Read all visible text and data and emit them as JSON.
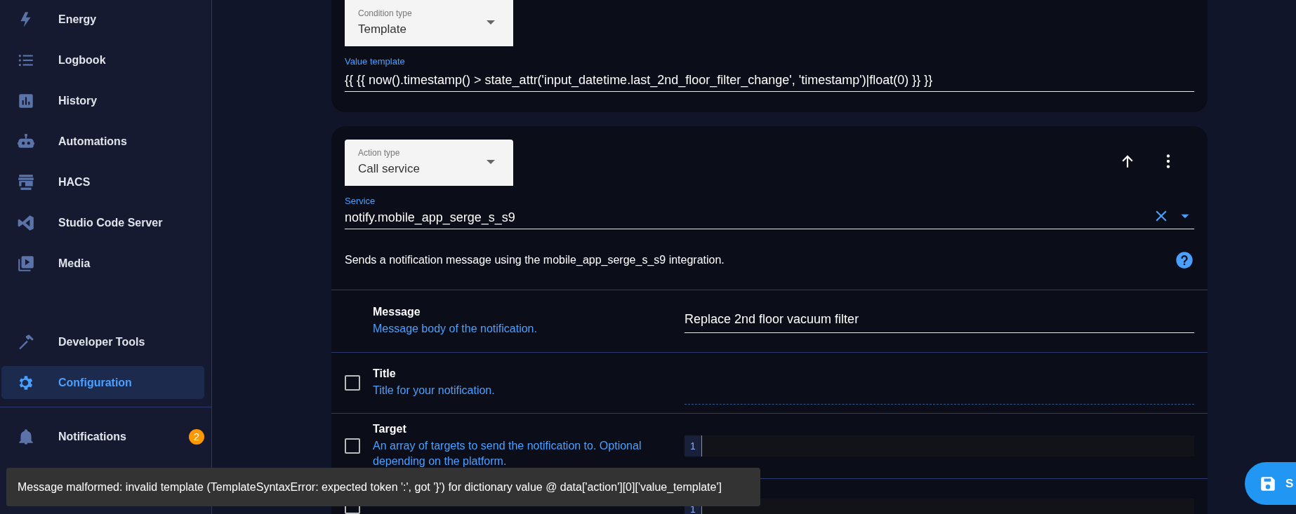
{
  "sidebar": {
    "items": [
      {
        "label": "Energy",
        "selected": false
      },
      {
        "label": "Logbook",
        "selected": false
      },
      {
        "label": "History",
        "selected": false
      },
      {
        "label": "Automations",
        "selected": false
      },
      {
        "label": "HACS",
        "selected": false
      },
      {
        "label": "Studio Code Server",
        "selected": false
      },
      {
        "label": "Media",
        "selected": false
      },
      {
        "label": "Developer Tools",
        "selected": false
      },
      {
        "label": "Configuration",
        "selected": true
      }
    ],
    "notifications": {
      "label": "Notifications",
      "badge": "2"
    }
  },
  "condition": {
    "type_label": "Condition type",
    "type_value": "Template",
    "field_label": "Value template",
    "field_value": "{{ {{ now().timestamp() > state_attr('input_datetime.last_2nd_floor_filter_change', 'timestamp')|float(0) }} }}"
  },
  "action": {
    "type_label": "Action type",
    "type_value": "Call service",
    "service_label": "Service",
    "service_value": "notify.mobile_app_serge_s_s9",
    "description": "Sends a notification message using the mobile_app_serge_s_s9 integration.",
    "fields": [
      {
        "kind": "text",
        "name": "Message",
        "description": "Message body of the notification.",
        "value": "Replace 2nd floor vacuum filter"
      },
      {
        "kind": "text",
        "name": "Title",
        "description": "Title for your notification.",
        "checked": false
      },
      {
        "kind": "code",
        "name": "Target",
        "description": "An array of targets to send the notification to. Optional depending on the platform.",
        "checked": false,
        "line": "1"
      },
      {
        "kind": "code",
        "checked": false,
        "line": "1"
      }
    ]
  },
  "toast": {
    "text": "Message malformed: invalid template (TemplateSyntaxError: expected token ':', got '}') for dictionary value @ data['action'][0]['value_template']"
  },
  "save_button": {
    "label": "S"
  }
}
